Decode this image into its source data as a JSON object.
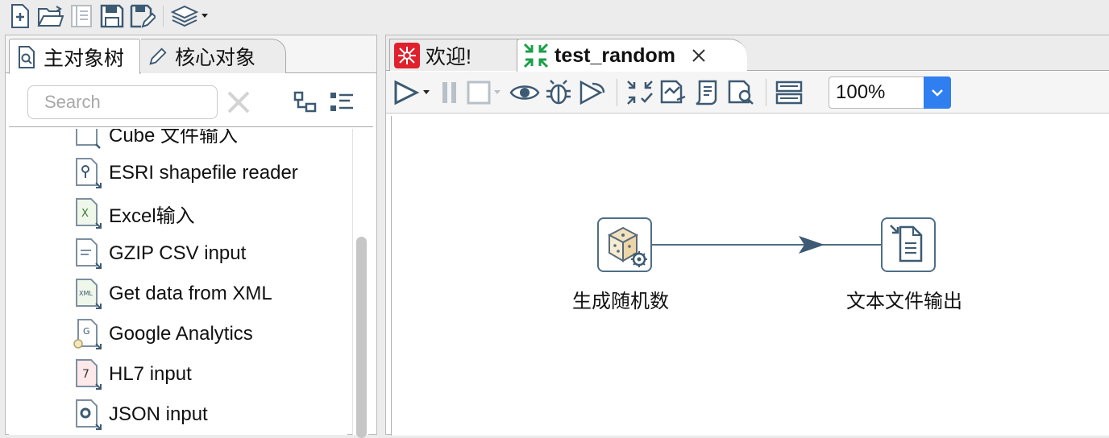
{
  "toolbar": {
    "icons": [
      "new-file-icon",
      "open-folder-icon",
      "explore-repository-icon",
      "save-icon",
      "save-as-icon",
      "perspective-layers-icon"
    ]
  },
  "left_panel": {
    "tabs": [
      {
        "label": "主对象树",
        "icon": "object-tree-icon",
        "active": true
      },
      {
        "label": "核心对象",
        "icon": "pencil-icon",
        "active": false
      }
    ],
    "search": {
      "placeholder": "Search"
    },
    "tree_items": [
      {
        "label": "Cube 文件输入",
        "icon": "cube-input-icon"
      },
      {
        "label": "ESRI shapefile reader",
        "icon": "esri-shapefile-icon"
      },
      {
        "label": "Excel输入",
        "icon": "excel-input-icon"
      },
      {
        "label": "GZIP CSV input",
        "icon": "gzip-csv-icon"
      },
      {
        "label": "Get data from XML",
        "icon": "xml-input-icon"
      },
      {
        "label": "Google Analytics",
        "icon": "google-analytics-icon"
      },
      {
        "label": "HL7 input",
        "icon": "hl7-input-icon"
      },
      {
        "label": "JSON input",
        "icon": "json-input-icon"
      }
    ]
  },
  "editor": {
    "tabs": [
      {
        "label": "欢迎!",
        "icon": "welcome-icon",
        "active": false
      },
      {
        "label": "test_random",
        "icon": "transformation-icon",
        "active": true
      }
    ],
    "toolbar": {
      "zoom": "100%",
      "icons": [
        "run-icon",
        "pause-icon",
        "stop-icon",
        "preview-icon",
        "debug-icon",
        "replay-icon",
        "verify-icon",
        "impact-icon",
        "sql-icon",
        "explore-db-icon",
        "show-results-icon"
      ]
    },
    "canvas": {
      "steps": [
        {
          "label": "生成随机数",
          "icon": "random-generator-icon"
        },
        {
          "label": "文本文件输出",
          "icon": "text-file-output-icon"
        }
      ],
      "hops": [
        {
          "from": "生成随机数",
          "to": "文本文件输出"
        }
      ]
    }
  },
  "colors": {
    "accent": "#2f7ff0",
    "step_border": "#4e6e86",
    "icon_stroke": "#3d5a73",
    "welcome_red": "#e0202c",
    "transform_green": "#1aa04a"
  }
}
